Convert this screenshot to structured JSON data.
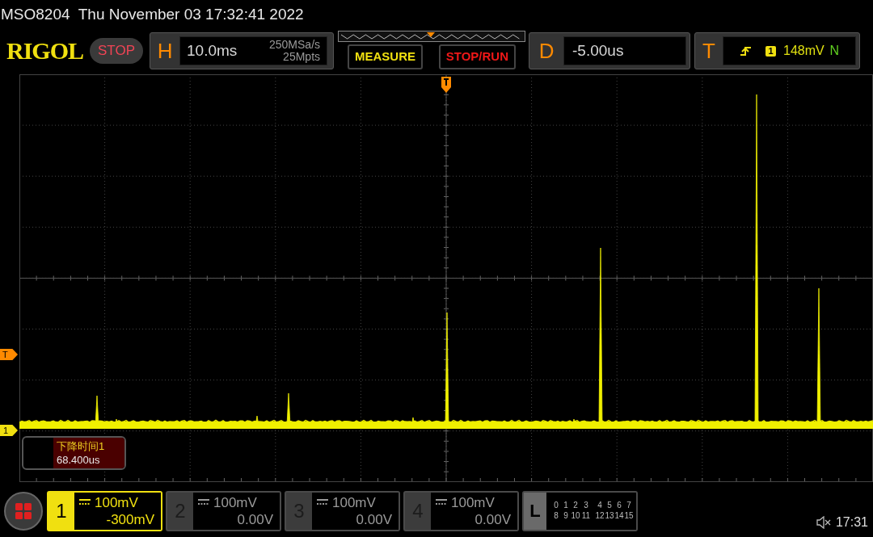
{
  "status_line": "MSO8204  Thu November 03 17:32:41 2022",
  "logo": "RIGOL",
  "run_state": "STOP",
  "horizontal": {
    "label": "H",
    "timebase": "10.0ms",
    "sample_rate": "250MSa/s",
    "memory_depth": "25Mpts"
  },
  "buttons": [
    "MEASURE",
    "STOP/RUN"
  ],
  "delay": {
    "label": "D",
    "value": "-5.00us"
  },
  "trigger": {
    "label": "T",
    "source": "1",
    "level": "148mV",
    "mode": "N"
  },
  "markers": {
    "trigger_level": "T",
    "channel": "1"
  },
  "measurement": {
    "name": "下降时间1",
    "value": "68.400us"
  },
  "channels": [
    {
      "number": "1",
      "scale": "100mV",
      "offset": "-300mV",
      "selected": true
    },
    {
      "number": "2",
      "scale": "100mV",
      "offset": "0.00V",
      "selected": false
    },
    {
      "number": "3",
      "scale": "100mV",
      "offset": "0.00V",
      "selected": false
    },
    {
      "number": "4",
      "scale": "100mV",
      "offset": "0.00V",
      "selected": false
    }
  ],
  "logic": {
    "label": "L",
    "row_1": [
      "0",
      "1",
      "2",
      "3",
      "4",
      "5",
      "6",
      "7"
    ],
    "row_2": [
      "8",
      "9",
      "10",
      "11",
      "12",
      "13",
      "14",
      "15"
    ]
  },
  "clock": "17:31"
}
